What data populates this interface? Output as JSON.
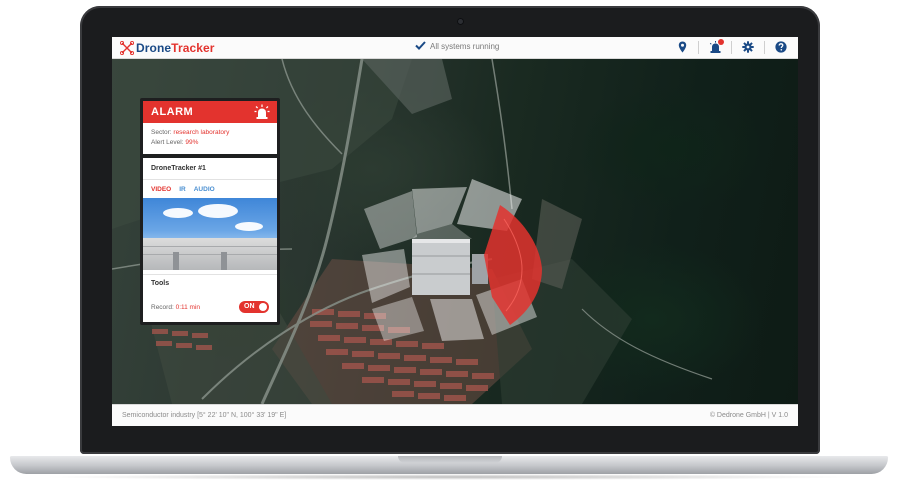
{
  "app": {
    "logo_prefix": "Drone",
    "logo_suffix": "Tracker",
    "status_text": "All systems running"
  },
  "toolbar": {
    "icons": [
      "location-pin-icon",
      "alarm-beacon-icon",
      "gear-icon",
      "help-icon"
    ]
  },
  "alarm": {
    "title": "ALARM",
    "sector_label": "Sector:",
    "sector_value": "research laboratory",
    "level_label": "Alert Level:",
    "level_value": "99%"
  },
  "tracker": {
    "title": "DroneTracker #1",
    "tabs": [
      "VIDEO",
      "IR",
      "AUDIO"
    ],
    "active_tab": "VIDEO",
    "tools_label": "Tools",
    "record_label": "Record:",
    "record_value": "0:11 min",
    "toggle_label": "ON",
    "toggle_on": true
  },
  "footer": {
    "location": "Semiconductor industry [5° 22' 10\" N, 100° 33' 19\" E]",
    "credit": "© Dedrone GmbH  |  V 1.0"
  },
  "colors": {
    "accent_red": "#e3332e",
    "brand_blue": "#1a4a86",
    "link_blue": "#4a8fd1",
    "status_green_check": "#1a4a86"
  }
}
